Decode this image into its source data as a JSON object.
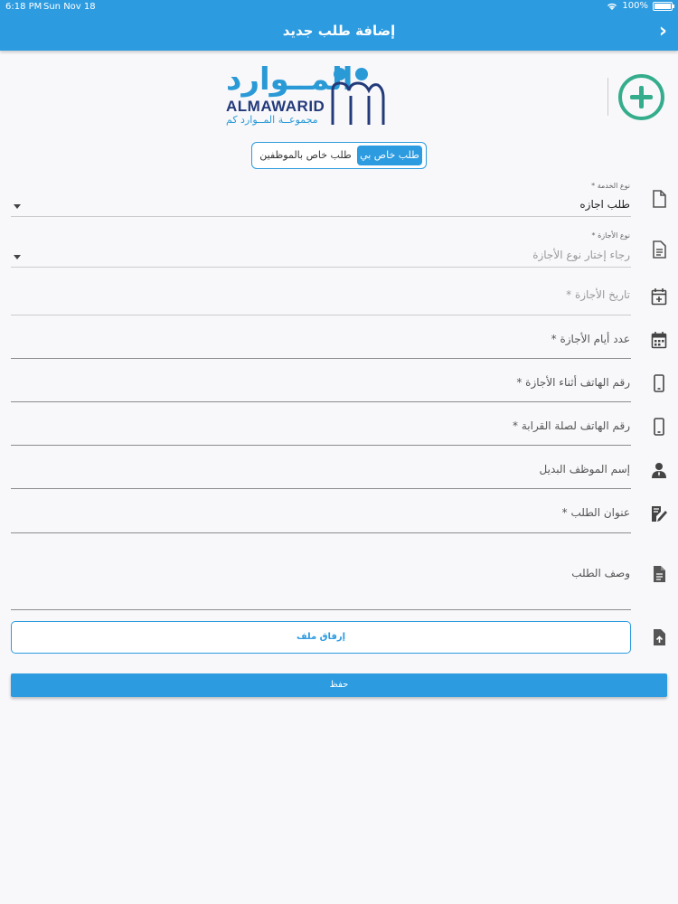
{
  "status_bar": {
    "time": "6:18 PM",
    "date": "Sun Nov 18",
    "battery": "100%",
    "battery_level": 1.0
  },
  "nav": {
    "title": "إضافة طلب جديد",
    "back_icon": "chevron-right-icon"
  },
  "add_button": {
    "icon": "plus-circle-icon",
    "color": "#35ad8c"
  },
  "logo": {
    "arabic": "المــوارد",
    "english": "ALMAWARID",
    "subtitle": "مجموعــة المــوارد كم"
  },
  "segment": {
    "active": "طلب خاص بي",
    "other": "طلب خاص بالموظفين"
  },
  "form": {
    "service_type": {
      "label": "نوع الخدمة *",
      "value": "طلب اجازه"
    },
    "leave_type": {
      "label": "نوع الأجازة *",
      "placeholder": "رجاء إختار نوع الأجازة"
    },
    "leave_date": {
      "placeholder": "تاريخ الأجازة *"
    },
    "leave_days": {
      "placeholder": "عدد أيام الأجازة *"
    },
    "phone_during_leave": {
      "placeholder": "رقم الهاتف أثناء الأجازة *"
    },
    "relative_phone": {
      "placeholder": "رقم الهاتف لصلة القرابة *"
    },
    "substitute": {
      "placeholder": "إسم الموظف البديل"
    },
    "request_title": {
      "placeholder": "عنوان الطلب *"
    },
    "description": {
      "placeholder": "وصف الطلب"
    }
  },
  "attach_label": "إرفاق ملف",
  "save_label": "حفظ",
  "colors": {
    "primary": "#2c9be0",
    "accent": "#35ad8c",
    "logo_dark": "#233a7a"
  }
}
